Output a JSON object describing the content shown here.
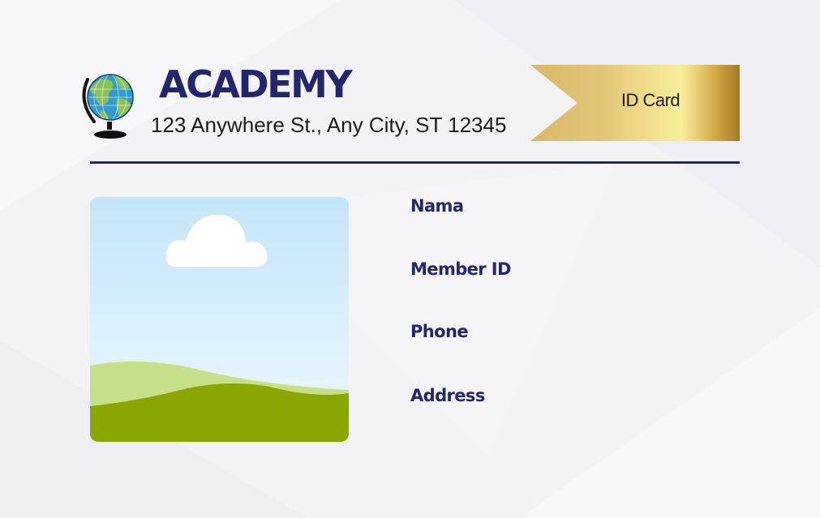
{
  "organization": {
    "name": "ACADEMY",
    "address": "123 Anywhere St., Any City, ST 12345"
  },
  "badge": {
    "label": "ID Card"
  },
  "fields": [
    {
      "label": "Nama"
    },
    {
      "label": "Member ID"
    },
    {
      "label": "Phone"
    },
    {
      "label": "Address"
    }
  ],
  "colors": {
    "primary": "#23266b",
    "background": "#f3f3f6",
    "gold_light": "#fbef9c",
    "gold_dark": "#a37a22",
    "sky": "#c4e6fa",
    "grass_light": "#c6e08a",
    "grass_dark": "#8aa600"
  },
  "icons": {
    "logo": "globe-icon",
    "photo": "image-placeholder-icon"
  }
}
